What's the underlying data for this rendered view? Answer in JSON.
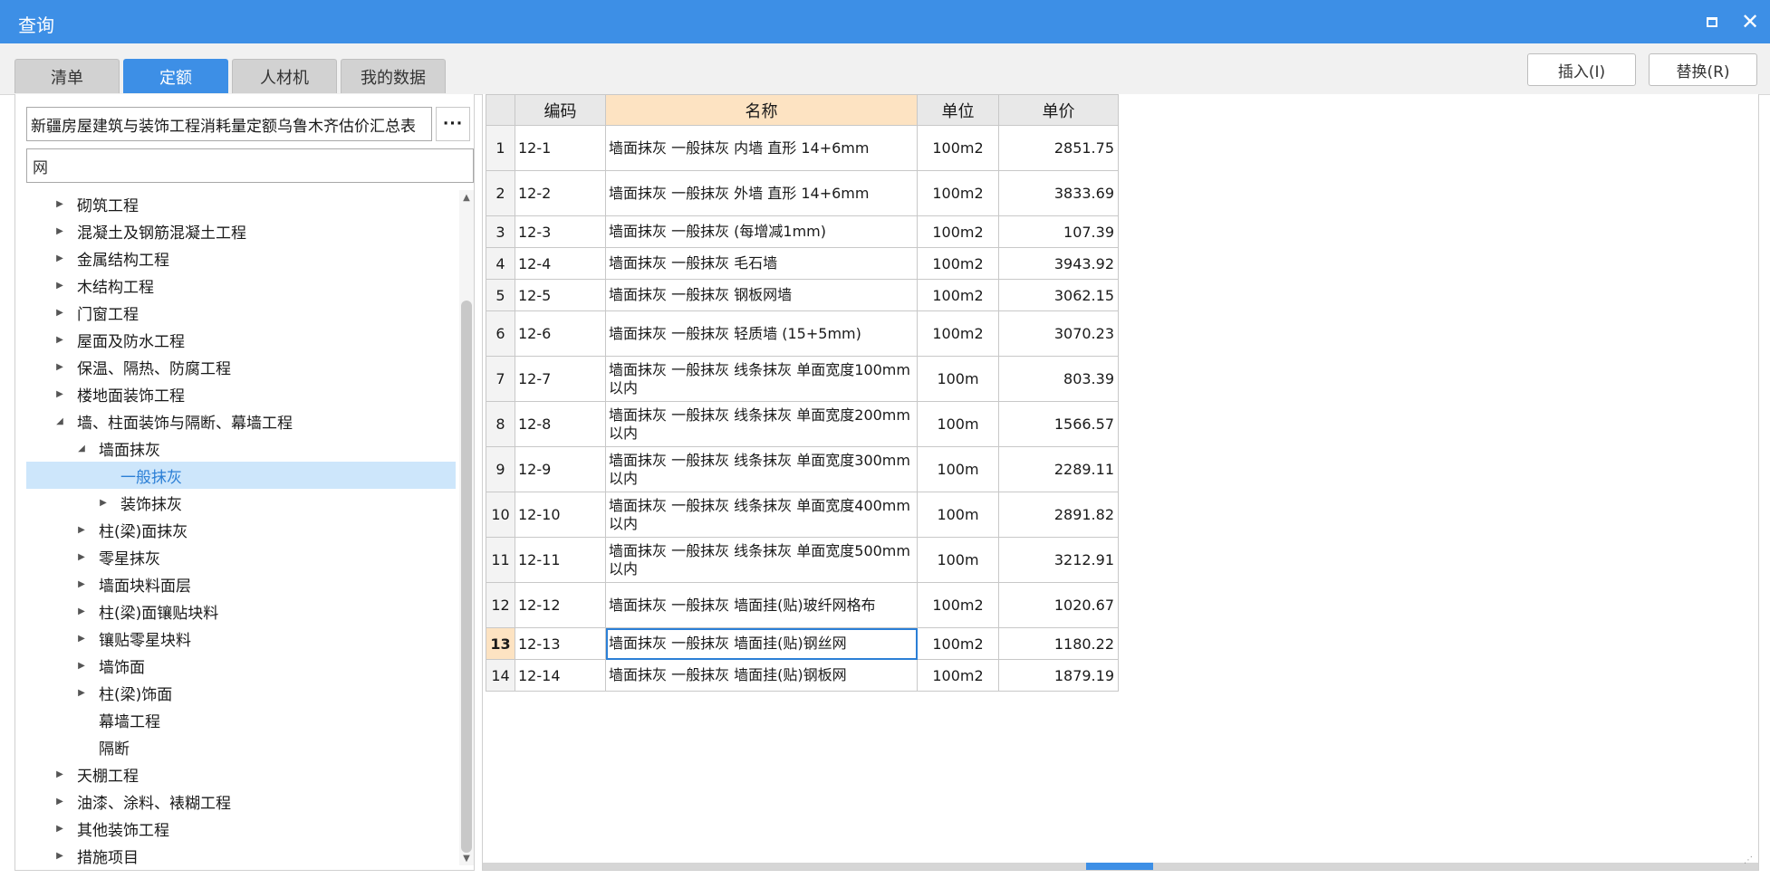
{
  "window": {
    "title": "查询"
  },
  "tabs": [
    {
      "label": "清单",
      "active": false
    },
    {
      "label": "定额",
      "active": true
    },
    {
      "label": "人材机",
      "active": false
    },
    {
      "label": "我的数据",
      "active": false
    }
  ],
  "actions": {
    "insert_label": "插入(I)",
    "replace_label": "替换(R)"
  },
  "library": {
    "name": "新疆房屋建筑与装饰工程消耗量定额乌鲁木齐估价汇总表",
    "more_label": "···"
  },
  "search": {
    "value": "网",
    "placeholder": ""
  },
  "tree": [
    {
      "label": "砌筑工程",
      "level": 0,
      "arrow": "right"
    },
    {
      "label": "混凝土及钢筋混凝土工程",
      "level": 0,
      "arrow": "right"
    },
    {
      "label": "金属结构工程",
      "level": 0,
      "arrow": "right"
    },
    {
      "label": "木结构工程",
      "level": 0,
      "arrow": "right"
    },
    {
      "label": "门窗工程",
      "level": 0,
      "arrow": "right"
    },
    {
      "label": "屋面及防水工程",
      "level": 0,
      "arrow": "right"
    },
    {
      "label": "保温、隔热、防腐工程",
      "level": 0,
      "arrow": "right"
    },
    {
      "label": "楼地面装饰工程",
      "level": 0,
      "arrow": "right"
    },
    {
      "label": "墙、柱面装饰与隔断、幕墙工程",
      "level": 0,
      "arrow": "down"
    },
    {
      "label": "墙面抹灰",
      "level": 1,
      "arrow": "down"
    },
    {
      "label": "一般抹灰",
      "level": 2,
      "arrow": "none",
      "selected": true
    },
    {
      "label": "装饰抹灰",
      "level": 2,
      "arrow": "right"
    },
    {
      "label": "柱(梁)面抹灰",
      "level": 1,
      "arrow": "right"
    },
    {
      "label": "零星抹灰",
      "level": 1,
      "arrow": "right"
    },
    {
      "label": "墙面块料面层",
      "level": 1,
      "arrow": "right"
    },
    {
      "label": "柱(梁)面镶贴块料",
      "level": 1,
      "arrow": "right"
    },
    {
      "label": "镶贴零星块料",
      "level": 1,
      "arrow": "right"
    },
    {
      "label": "墙饰面",
      "level": 1,
      "arrow": "right"
    },
    {
      "label": "柱(梁)饰面",
      "level": 1,
      "arrow": "right"
    },
    {
      "label": "幕墙工程",
      "level": 1,
      "arrow": "none"
    },
    {
      "label": "隔断",
      "level": 1,
      "arrow": "none"
    },
    {
      "label": "天棚工程",
      "level": 0,
      "arrow": "right"
    },
    {
      "label": "油漆、涂料、裱糊工程",
      "level": 0,
      "arrow": "right"
    },
    {
      "label": "其他装饰工程",
      "level": 0,
      "arrow": "right"
    },
    {
      "label": "措施项目",
      "level": 0,
      "arrow": "right"
    }
  ],
  "table": {
    "columns": [
      "编码",
      "名称",
      "单位",
      "单价"
    ],
    "rows": [
      {
        "idx": "1",
        "code": "12-1",
        "name": "墙面抹灰 一般抹灰 内墙 直形 14+6mm",
        "unit": "100m2",
        "price": "2851.75"
      },
      {
        "idx": "2",
        "code": "12-2",
        "name": "墙面抹灰 一般抹灰 外墙 直形 14+6mm",
        "unit": "100m2",
        "price": "3833.69"
      },
      {
        "idx": "3",
        "code": "12-3",
        "name": "墙面抹灰 一般抹灰 (每增减1mm)",
        "unit": "100m2",
        "price": "107.39"
      },
      {
        "idx": "4",
        "code": "12-4",
        "name": "墙面抹灰 一般抹灰 毛石墙",
        "unit": "100m2",
        "price": "3943.92"
      },
      {
        "idx": "5",
        "code": "12-5",
        "name": "墙面抹灰 一般抹灰 钢板网墙",
        "unit": "100m2",
        "price": "3062.15"
      },
      {
        "idx": "6",
        "code": "12-6",
        "name": "墙面抹灰 一般抹灰 轻质墙 (15+5mm)",
        "unit": "100m2",
        "price": "3070.23"
      },
      {
        "idx": "7",
        "code": "12-7",
        "name": "墙面抹灰 一般抹灰 线条抹灰 单面宽度100mm以内",
        "unit": "100m",
        "price": "803.39"
      },
      {
        "idx": "8",
        "code": "12-8",
        "name": "墙面抹灰 一般抹灰 线条抹灰 单面宽度200mm以内",
        "unit": "100m",
        "price": "1566.57"
      },
      {
        "idx": "9",
        "code": "12-9",
        "name": "墙面抹灰 一般抹灰 线条抹灰 单面宽度300mm以内",
        "unit": "100m",
        "price": "2289.11"
      },
      {
        "idx": "10",
        "code": "12-10",
        "name": "墙面抹灰 一般抹灰 线条抹灰 单面宽度400mm以内",
        "unit": "100m",
        "price": "2891.82"
      },
      {
        "idx": "11",
        "code": "12-11",
        "name": "墙面抹灰 一般抹灰 线条抹灰 单面宽度500mm以内",
        "unit": "100m",
        "price": "3212.91"
      },
      {
        "idx": "12",
        "code": "12-12",
        "name": "墙面抹灰 一般抹灰 墙面挂(贴)玻纤网格布",
        "unit": "100m2",
        "price": "1020.67"
      },
      {
        "idx": "13",
        "code": "12-13",
        "name": "墙面抹灰 一般抹灰 墙面挂(贴)钢丝网",
        "unit": "100m2",
        "price": "1180.22",
        "current": true
      },
      {
        "idx": "14",
        "code": "12-14",
        "name": "墙面抹灰 一般抹灰 墙面挂(贴)钢板网",
        "unit": "100m2",
        "price": "1879.19"
      }
    ]
  },
  "colors": {
    "accent": "#3d8fe6",
    "selection": "#cde6fb",
    "header_highlight": "#fde3c2"
  }
}
